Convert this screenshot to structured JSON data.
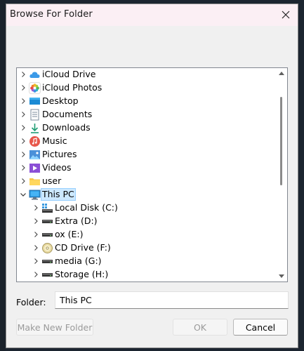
{
  "window": {
    "title": "Browse For Folder"
  },
  "tree": {
    "items": [
      {
        "label": "iCloud Drive",
        "icon": "icloud-drive-icon",
        "expanded": false
      },
      {
        "label": "iCloud Photos",
        "icon": "icloud-photos-icon",
        "expanded": false
      },
      {
        "label": "Desktop",
        "icon": "desktop-icon",
        "expanded": false
      },
      {
        "label": "Documents",
        "icon": "documents-icon",
        "expanded": false
      },
      {
        "label": "Downloads",
        "icon": "downloads-icon",
        "expanded": false
      },
      {
        "label": "Music",
        "icon": "music-icon",
        "expanded": false
      },
      {
        "label": "Pictures",
        "icon": "pictures-icon",
        "expanded": false
      },
      {
        "label": "Videos",
        "icon": "videos-icon",
        "expanded": false
      },
      {
        "label": "user",
        "icon": "user-folder-icon",
        "expanded": false
      },
      {
        "label": "This PC",
        "icon": "this-pc-icon",
        "expanded": true,
        "selected": true
      },
      {
        "label": "Local Disk (C:)",
        "icon": "system-drive-icon",
        "expanded": false
      },
      {
        "label": "Extra (D:)",
        "icon": "drive-icon",
        "expanded": false
      },
      {
        "label": "ox (E:)",
        "icon": "drive-icon",
        "expanded": false
      },
      {
        "label": "CD Drive (F:)",
        "icon": "cd-drive-icon",
        "expanded": false
      },
      {
        "label": "media (G:)",
        "icon": "drive-icon",
        "expanded": false
      },
      {
        "label": "Storage (H:)",
        "icon": "drive-icon",
        "expanded": false
      }
    ]
  },
  "folder": {
    "label": "Folder:",
    "value": "This PC"
  },
  "buttons": {
    "make_new_folder": "Make New Folder",
    "ok": "OK",
    "cancel": "Cancel"
  },
  "colors": {
    "selection_bg": "#cce8ff",
    "selection_border": "#99d1ff",
    "titlebar_bg": "#fbeff4"
  }
}
